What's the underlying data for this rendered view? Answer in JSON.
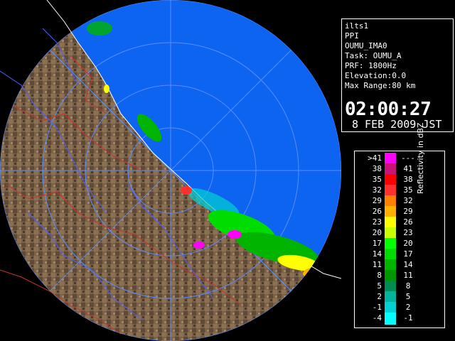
{
  "info": {
    "lines": [
      "ilts1",
      "PPI",
      "OUMU_IMA0",
      "Task: OUMU_A",
      "PRF: 1800Hz",
      "Elevation:0.0",
      "Max Range:80 km"
    ],
    "time": "02:00:27",
    "date": "8 FEB 2009 JST"
  },
  "legend": {
    "title": "Reflectivity in dBZ",
    "rows": [
      {
        "low": ">41",
        "high": "---",
        "color": "#ff00ff"
      },
      {
        "low": "38",
        "high": "41",
        "color": "#c81478"
      },
      {
        "low": "35",
        "high": "38",
        "color": "#ff0000"
      },
      {
        "low": "32",
        "high": "35",
        "color": "#ff3030"
      },
      {
        "low": "29",
        "high": "32",
        "color": "#ff8000"
      },
      {
        "low": "26",
        "high": "29",
        "color": "#ffb000"
      },
      {
        "low": "23",
        "high": "26",
        "color": "#ffff00"
      },
      {
        "low": "20",
        "high": "23",
        "color": "#c8ff00"
      },
      {
        "low": "17",
        "high": "20",
        "color": "#00ff00"
      },
      {
        "low": "14",
        "high": "17",
        "color": "#00dc00"
      },
      {
        "low": "11",
        "high": "14",
        "color": "#00b400"
      },
      {
        "low": "8",
        "high": "11",
        "color": "#009600"
      },
      {
        "low": "5",
        "high": "8",
        "color": "#008c50"
      },
      {
        "low": "2",
        "high": "5",
        "color": "#00b4a0"
      },
      {
        "low": "-1",
        "high": "2",
        "color": "#00d2d2"
      },
      {
        "low": "-4",
        "high": "-1",
        "color": "#00ffff"
      }
    ]
  },
  "colors": {
    "sea": "#0c64f0",
    "outside_sea": "#0a3cc8",
    "land": "#7a6248",
    "range_rings": "#5a8cff",
    "coastline": "#ffffff",
    "rivers": "#5060ff",
    "boundaries": "#c83232"
  }
}
